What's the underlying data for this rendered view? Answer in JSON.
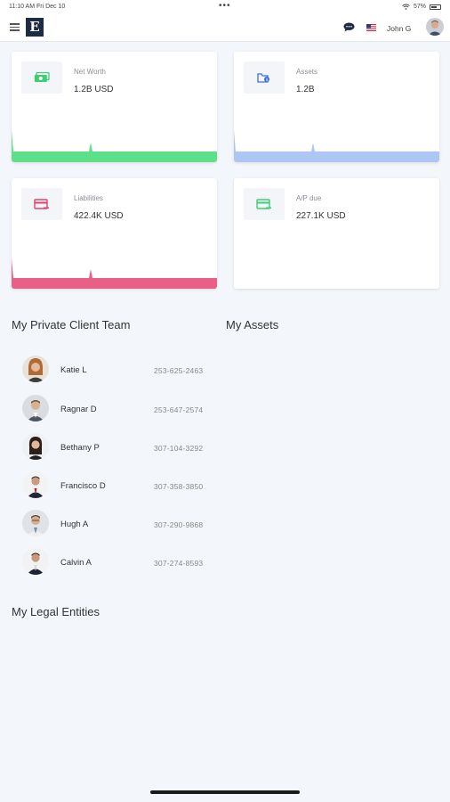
{
  "status_bar": {
    "time": "11:10 AM   Fri Dec 10",
    "dots": "•••",
    "battery": "57%"
  },
  "header": {
    "logo_letter": "E",
    "user_name": "John G"
  },
  "cards": [
    {
      "label": "Net Worth",
      "value": "1.2B USD",
      "icon": "money-icon",
      "accent": "#5ee08a"
    },
    {
      "label": "Assets",
      "value": "1.2B",
      "icon": "assets-icon",
      "accent": "#aec6f3"
    },
    {
      "label": "Liabilities",
      "value": "422.4K USD",
      "icon": "credit-card-icon",
      "accent": "#ea5f86"
    },
    {
      "label": "A/P due",
      "value": "227.1K USD",
      "icon": "credit-card-icon",
      "accent": "#3ccf75"
    }
  ],
  "sections": {
    "team_title": "My Private Client Team",
    "assets_title": "My Assets",
    "legal_title": "My Legal Entities"
  },
  "team": [
    {
      "name": "Katie L",
      "phone": "253-625-2463"
    },
    {
      "name": "Ragnar D",
      "phone": "253-647-2574"
    },
    {
      "name": "Bethany P",
      "phone": "307-104-3292"
    },
    {
      "name": "Francisco D",
      "phone": "307-358-3850"
    },
    {
      "name": "Hugh A",
      "phone": "307-290-9868"
    },
    {
      "name": "Calvin A",
      "phone": "307-274-8593"
    }
  ]
}
